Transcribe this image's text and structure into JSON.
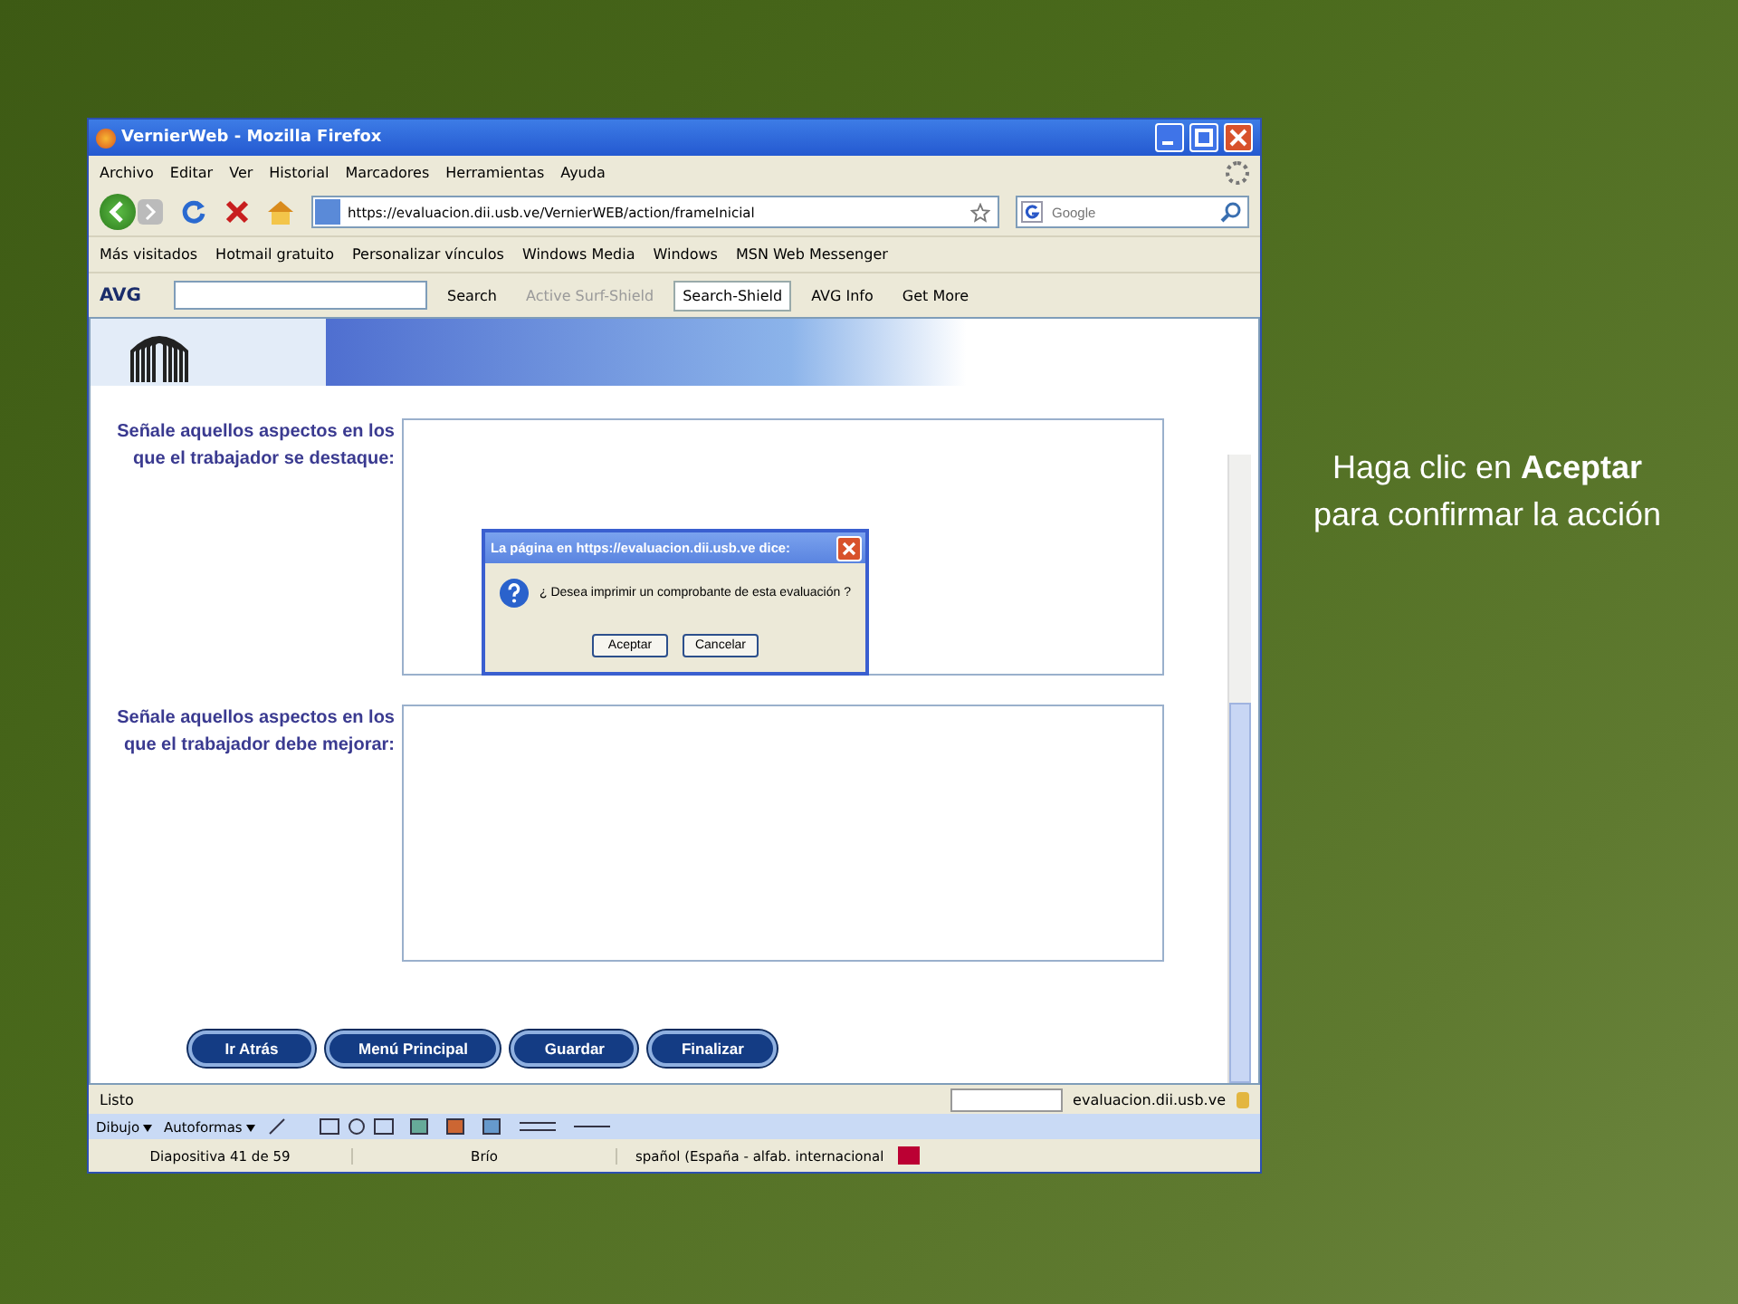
{
  "slide": {
    "caption": "Haga clic en **Aceptar** para confirmar la acción"
  },
  "window": {
    "title": "VernierWeb - Mozilla Firefox"
  },
  "menu": [
    "Archivo",
    "Editar",
    "Ver",
    "Historial",
    "Marcadores",
    "Herramientas",
    "Ayuda"
  ],
  "address": {
    "url": "https://evaluacion.dii.usb.ve/VernierWEB/action/frameInicial"
  },
  "search": {
    "placeholder": "Google"
  },
  "bookmarks": [
    "Más visitados",
    "Hotmail gratuito",
    "Personalizar vínculos",
    "Windows Media",
    "Windows",
    "MSN Web Messenger"
  ],
  "avg_toolbar": {
    "logo": "AVG",
    "items": [
      {
        "label": "Search",
        "disabled": false,
        "selected": false
      },
      {
        "label": "Active Surf-Shield",
        "disabled": true,
        "selected": false
      },
      {
        "label": "Search-Shield",
        "disabled": false,
        "selected": true
      },
      {
        "label": "AVG Info",
        "disabled": false,
        "selected": false
      },
      {
        "label": "Get More",
        "disabled": false,
        "selected": false
      }
    ]
  },
  "form": {
    "fields": [
      {
        "label": "Señale aquellos aspectos en los que el trabajador se destaque:"
      },
      {
        "label": "Señale aquellos aspectos en los que el trabajador debe mejorar:"
      }
    ],
    "buttons": [
      "Ir Atrás",
      "Menú Principal",
      "Guardar",
      "Finalizar"
    ]
  },
  "dialog": {
    "title": "La página en https://evaluacion.dii.usb.ve dice:",
    "message": "¿ Desea imprimir un comprobante de esta evaluación ?",
    "buttons": [
      "Aceptar",
      "Cancelar"
    ]
  },
  "status_bar": {
    "text": "Listo",
    "host": "evaluacion.dii.usb.ve"
  },
  "drawing_toolbar": [
    "Dibujo",
    "Autoformas"
  ],
  "app_status": [
    "Diapositiva 41 de 59",
    "Brío",
    "spañol (España - alfab. internacional"
  ]
}
